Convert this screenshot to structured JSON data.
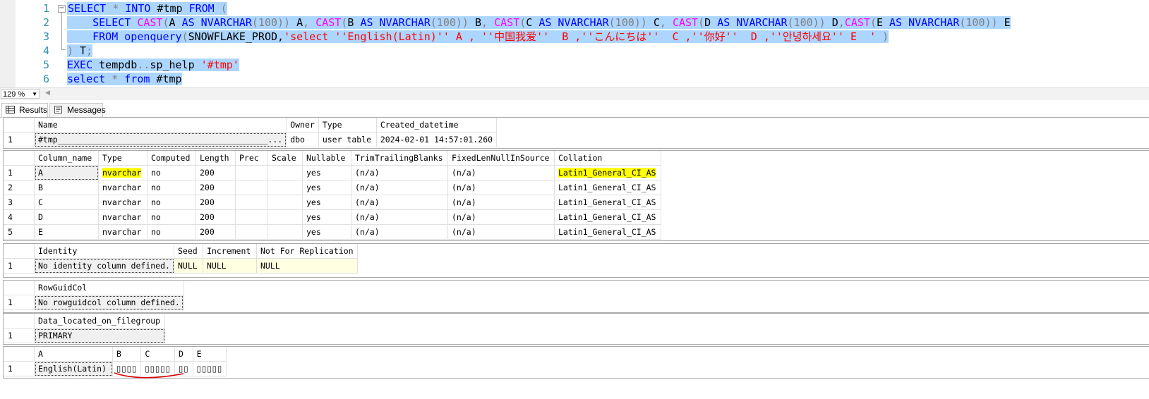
{
  "editor": {
    "line_numbers": [
      "1",
      "2",
      "3",
      "4",
      "5",
      "6"
    ],
    "line1": {
      "kw1": "SELECT",
      "op1": " * ",
      "kw2": "INTO",
      "t1": " #tmp ",
      "kw3": "FROM",
      "p1": " ("
    },
    "line2": {
      "indent": "    ",
      "kw1": "SELECT",
      "sp": " ",
      "fa": "CAST",
      "pa": "(",
      "ca": "A ",
      "asa": "AS",
      "ta": " NVARCHAR",
      "na": "(100))",
      "aa": " A",
      "cm1": ", ",
      "fb": "CAST",
      "pb": "(",
      "cb": "B ",
      "asb": "AS",
      "tb": " NVARCHAR",
      "nb": "(100))",
      "ab": " B",
      "cm2": ", ",
      "fc": "CAST",
      "pc": "(",
      "cc": "C ",
      "asc": "AS",
      "tc": " NVARCHAR",
      "nc": "(100))",
      "ac": " C",
      "cm3": ", ",
      "fd": "CAST",
      "pd": "(",
      "cd": "D ",
      "asd": "AS",
      "td": " NVARCHAR",
      "nd": "(100))",
      "ad": " D",
      "cm4": ",",
      "fe": "CAST",
      "pe": "(",
      "ce": "E ",
      "ase": "AS",
      "te": " NVARCHAR",
      "ne": "(100))",
      "ae": " E"
    },
    "line3": {
      "indent": "    ",
      "kw1": "FROM",
      "sp": " ",
      "fn": "openquery",
      "p1": "(",
      "tx": "SNOWFLAKE_PROD,",
      "str": "'select ''English(Latin)'' A , ''中国我爱''  B ,''こんにちは''  C ,''你好''  D ,''안녕하세요'' E  '",
      "p2": " )"
    },
    "line4": {
      "p1": ")",
      "tx": " T",
      "p2": ";"
    },
    "line5": {
      "kw1": "EXEC",
      "tx1": " tempdb",
      "dots": "..",
      "tx2": "sp_help ",
      "str": "'#tmp'"
    },
    "line6": {
      "kw1": "select",
      "op": " * ",
      "kw2": "from",
      "tx": " #tmp"
    }
  },
  "zoom": {
    "value": "129 %"
  },
  "tabs": {
    "results_label": "Results",
    "messages_label": "Messages"
  },
  "grid1": {
    "headers": [
      "Name",
      "Owner",
      "Type",
      "Created_datetime"
    ],
    "row": {
      "n": "1",
      "name": "#tmp___________________________________________...",
      "owner": "dbo",
      "type": "user table",
      "created": "2024-02-01 14:57:01.260"
    }
  },
  "grid2": {
    "headers": [
      "Column_name",
      "Type",
      "Computed",
      "Length",
      "Prec",
      "Scale",
      "Nullable",
      "TrimTrailingBlanks",
      "FixedLenNullInSource",
      "Collation"
    ],
    "rows": [
      [
        "1",
        "A",
        "nvarchar",
        "no",
        "200",
        "",
        "",
        "yes",
        "(n/a)",
        "(n/a)",
        "Latin1_General_CI_AS"
      ],
      [
        "2",
        "B",
        "nvarchar",
        "no",
        "200",
        "",
        "",
        "yes",
        "(n/a)",
        "(n/a)",
        "Latin1_General_CI_AS"
      ],
      [
        "3",
        "C",
        "nvarchar",
        "no",
        "200",
        "",
        "",
        "yes",
        "(n/a)",
        "(n/a)",
        "Latin1_General_CI_AS"
      ],
      [
        "4",
        "D",
        "nvarchar",
        "no",
        "200",
        "",
        "",
        "yes",
        "(n/a)",
        "(n/a)",
        "Latin1_General_CI_AS"
      ],
      [
        "5",
        "E",
        "nvarchar",
        "no",
        "200",
        "",
        "",
        "yes",
        "(n/a)",
        "(n/a)",
        "Latin1_General_CI_AS"
      ]
    ]
  },
  "grid3": {
    "headers": [
      "Identity",
      "Seed",
      "Increment",
      "Not For Replication"
    ],
    "row": [
      "1",
      "No identity column defined.",
      "NULL",
      "NULL",
      "NULL"
    ]
  },
  "grid4": {
    "header": "RowGuidCol",
    "row": [
      "1",
      "No rowguidcol column defined."
    ]
  },
  "grid5": {
    "header": "Data_located_on_filegroup",
    "row": [
      "1",
      "PRIMARY"
    ]
  },
  "grid6": {
    "headers": [
      "A",
      "B",
      "C",
      "D",
      "E"
    ],
    "row": [
      "1",
      "English(Latin)",
      "▯▯▯▯",
      "▯▯▯▯▯",
      "▯▯",
      "▯▯▯▯▯"
    ]
  },
  "colors": {
    "selection": "#add6ff",
    "highlight": "#ffff00",
    "keyword": "#0000ff",
    "function": "#ff00ff",
    "string": "#ff0000",
    "annotation": "#e00000"
  },
  "icons": [
    "collapse-icon",
    "results-grid-icon",
    "messages-icon",
    "dropdown-arrow-icon"
  ]
}
